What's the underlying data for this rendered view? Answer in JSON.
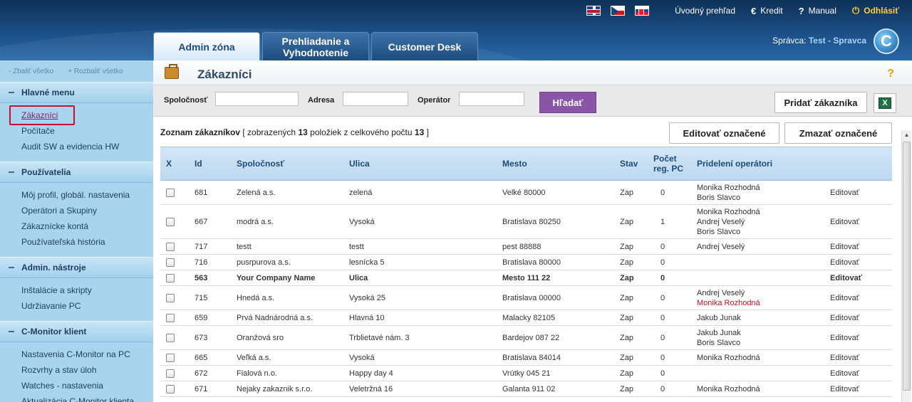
{
  "topnav": {
    "flags": [
      "en-flag",
      "cz-flag",
      "sk-flag"
    ],
    "overview": "Úvodný prehľad",
    "credit": "Kredit",
    "manual": "Manual",
    "logout": "Odhlásiť"
  },
  "tabs": [
    {
      "label": "Admin zóna",
      "active": true
    },
    {
      "label": "Prehliadanie a Vyhodnotenie",
      "active": false
    },
    {
      "label": "Customer Desk",
      "active": false
    }
  ],
  "admin": {
    "label": "Správca:",
    "name": "Test - Spravca"
  },
  "logo_letter": "C",
  "sidebar": {
    "collapse_all": "- Zbaliť všetko",
    "expand_all": "+ Rozbaliť všetko",
    "sections": [
      {
        "title": "Hlavné menu",
        "items": [
          "Zákazníci",
          "Počítače",
          "Audit SW a evidencia HW"
        ]
      },
      {
        "title": "Používatelia",
        "items": [
          "Môj profil, globál. nastavenia",
          "Operátori a Skupiny",
          "Zákaznícke kontá",
          "Používateľská história"
        ]
      },
      {
        "title": "Admin. nástroje",
        "items": [
          "Inštalácie a skripty",
          "Udržiavanie PC"
        ]
      },
      {
        "title": "C-Monitor klient",
        "items": [
          "Nastavenia C-Monitor na PC",
          "Rozvrhy a stav úloh",
          "Watches - nastavenia",
          "Aktualizácia C-Monitor klienta"
        ]
      }
    ]
  },
  "page": {
    "title": "Zákazníci",
    "help": "?"
  },
  "filter": {
    "company_label": "Spoločnosť",
    "address_label": "Adresa",
    "operator_label": "Operátor",
    "search_button": "Hľadať",
    "add_button": "Pridať zákazníka",
    "excel_icon": "X"
  },
  "list": {
    "title": "Zoznam zákazníkov",
    "shown_prefix": "[ zobrazených",
    "shown": "13",
    "mid": "položiek z celkového počtu",
    "total": "13",
    "suffix": "]",
    "edit_selected": "Editovať označené",
    "delete_selected": "Zmazať označené"
  },
  "table": {
    "headers": {
      "x": "X",
      "id": "Id",
      "company": "Spoločnosť",
      "street": "Ulica",
      "city": "Mesto",
      "status": "Stav",
      "pc_count": "Počet reg. PC",
      "operators": "Pridelení operátori"
    },
    "rows": [
      {
        "id": "681",
        "company": "Zelená a.s.",
        "street": "zelená",
        "city": "Velké 80000",
        "status": "Zap",
        "pc": "0",
        "ops": [
          "Monika Rozhodná",
          "Boris Slavco"
        ],
        "edit": "Editovať"
      },
      {
        "id": "667",
        "company": "modrá a.s.",
        "street": "Vysoká",
        "city": "Bratislava 80250",
        "status": "Zap",
        "pc": "1",
        "ops": [
          "Monika Rozhodná",
          "Andrej Veselý",
          "Boris Slavco"
        ],
        "edit": "Editovať"
      },
      {
        "id": "717",
        "company": "testt",
        "street": "testt",
        "city": "pest 88888",
        "status": "Zap",
        "pc": "0",
        "ops": [
          "Andrej Veselý"
        ],
        "edit": "Editovať"
      },
      {
        "id": "716",
        "company": "pusrpurova a.s.",
        "street": "lesnícka 5",
        "city": "Bratislava 80000",
        "status": "Zap",
        "pc": "0",
        "ops": [],
        "edit": "Editovať"
      },
      {
        "id": "563",
        "company": "Your Company Name",
        "street": "Ulica",
        "city": "Mesto 111 22",
        "status": "Zap",
        "pc": "0",
        "ops": [],
        "edit": "Editovať",
        "bold": true
      },
      {
        "id": "715",
        "company": "Hnedá a.s.",
        "street": "Vysoká 25",
        "city": "Bratislava 00000",
        "status": "Zap",
        "pc": "0",
        "ops": [
          "Andrej Veselý",
          "Monika Rozhodná"
        ],
        "red_op": 1,
        "edit": "Editovať"
      },
      {
        "id": "659",
        "company": "Prvá Nadnárodná a.s.",
        "street": "Hlavná 10",
        "city": "Malacky 82105",
        "status": "Zap",
        "pc": "0",
        "ops": [
          "Jakub Junak"
        ],
        "edit": "Editovať"
      },
      {
        "id": "673",
        "company": "Oranžová sro",
        "street": "Trblietavé nám. 3",
        "city": "Bardejov 087 22",
        "status": "Zap",
        "pc": "0",
        "ops": [
          "Jakub Junak",
          "Boris Slavco"
        ],
        "edit": "Editovať"
      },
      {
        "id": "665",
        "company": "Veľká a.s.",
        "street": "Vysoká",
        "city": "Bratislava 84014",
        "status": "Zap",
        "pc": "0",
        "ops": [
          "Monika Rozhodná"
        ],
        "edit": "Editovať"
      },
      {
        "id": "672",
        "company": "Fialová n.o.",
        "street": "Happy day 4",
        "city": "Vrútky 045 21",
        "status": "Zap",
        "pc": "0",
        "ops": [],
        "edit": "Editovať"
      },
      {
        "id": "671",
        "company": "Nejaky zakaznik s.r.o.",
        "street": "Veletržná 16",
        "city": "Galanta 911 02",
        "status": "Zap",
        "pc": "0",
        "ops": [
          "Monika Rozhodná"
        ],
        "edit": "Editovať"
      }
    ]
  },
  "colors": {
    "accent": "#8a55a8",
    "header_blue": "#1b4f87",
    "sidebar": "#a9d4ee",
    "logout": "#ffcc33"
  }
}
